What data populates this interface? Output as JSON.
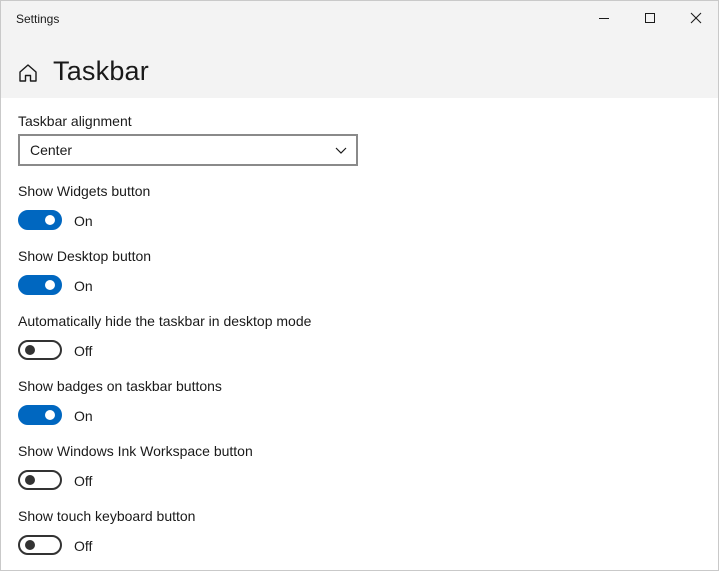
{
  "window": {
    "title": "Settings"
  },
  "header": {
    "title": "Taskbar",
    "home_icon": "home-icon"
  },
  "alignment": {
    "label": "Taskbar alignment",
    "value": "Center"
  },
  "settings": [
    {
      "label": "Show Widgets button",
      "state": "On",
      "on": true
    },
    {
      "label": "Show Desktop button",
      "state": "On",
      "on": true
    },
    {
      "label": "Automatically hide the taskbar in desktop mode",
      "state": "Off",
      "on": false
    },
    {
      "label": "Show badges on taskbar buttons",
      "state": "On",
      "on": true
    },
    {
      "label": "Show Windows Ink Workspace button",
      "state": "Off",
      "on": false
    },
    {
      "label": "Show touch keyboard button",
      "state": "Off",
      "on": false
    }
  ],
  "colors": {
    "accent": "#0067c0",
    "header_bg": "#f3f3f3",
    "text": "#1a1a1a"
  }
}
